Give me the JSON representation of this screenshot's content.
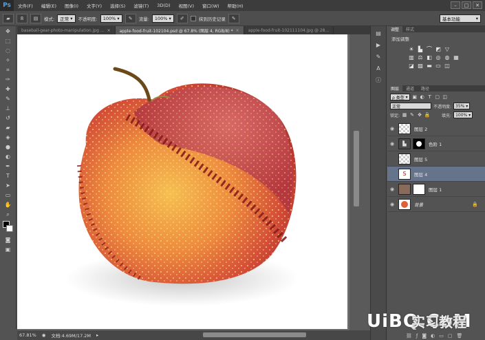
{
  "app": {
    "logo": "Ps"
  },
  "menu": [
    "文件(F)",
    "编辑(E)",
    "图像(I)",
    "文字(Y)",
    "选择(S)",
    "滤镜(T)",
    "3D(D)",
    "视图(V)",
    "窗口(W)",
    "帮助(H)"
  ],
  "window_controls": [
    "–",
    "□",
    "✕"
  ],
  "options": {
    "brush_size": "8",
    "mode_label": "模式:",
    "mode_value": "正常",
    "opacity_label": "不透明度:",
    "opacity_value": "100%",
    "flow_label": "流量:",
    "flow_value": "100%",
    "history_label": "抹到历史记录",
    "workspace": "基本功能"
  },
  "tabs": [
    {
      "label": "baseball-gear-photo-manipulation.jpg ...",
      "active": false
    },
    {
      "label": "apple-food-fruit-102104.psd @ 67.8% (图层 4, RGB/8) *",
      "active": true
    },
    {
      "label": "apple-food-fruit-102111104.jpg @ 28...",
      "active": false
    }
  ],
  "status": {
    "zoom": "67.81%",
    "doc": "文档:4.69M/17.2M"
  },
  "panel": {
    "tab_adjust": "调整",
    "tab_style": "样式",
    "adjust_title": "添加调整",
    "tab_layers": "图层",
    "tab_channels": "通道",
    "tab_paths": "路径",
    "kind_label": "ρ 类型",
    "blend_mode": "正常",
    "opacity_label": "不透明度:",
    "opacity_value": "35%",
    "lock_label": "锁定:",
    "fill_label": "填充:",
    "fill_value": "100%"
  },
  "layers": [
    {
      "name": "图层 2",
      "selected": false
    },
    {
      "name": "色阶 1",
      "selected": false
    },
    {
      "name": "图层 5",
      "selected": false
    },
    {
      "name": "图层 4",
      "selected": true
    },
    {
      "name": "图层 1",
      "selected": false
    },
    {
      "name": "背景",
      "selected": false
    }
  ],
  "watermark": {
    "latin": "UiBQ.CoM",
    "chinese": "实习教程"
  },
  "colors": {
    "selected_layer": "#65748a",
    "canvas_bg": "#ffffff",
    "app_bg": "#535353"
  }
}
